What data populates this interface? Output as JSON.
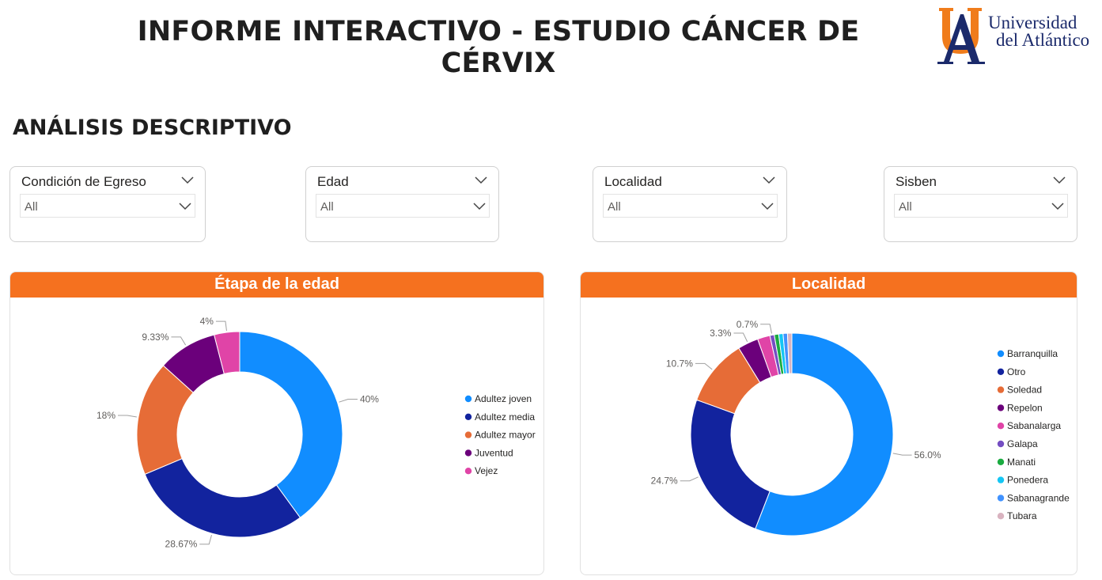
{
  "header": {
    "title": "INFORME INTERACTIVO - ESTUDIO CÁNCER DE CÉRVIX",
    "logo_line1": "Universidad",
    "logo_line2": "del Atlántico"
  },
  "section_title": "ANÁLISIS DESCRIPTIVO",
  "filters": [
    {
      "label": "Condición de Egreso",
      "value": "All"
    },
    {
      "label": "Edad",
      "value": "All"
    },
    {
      "label": "Localidad",
      "value": "All"
    },
    {
      "label": "Sisben",
      "value": "All"
    }
  ],
  "colors": {
    "accent": "#f5711f",
    "logo_orange": "#f07c1b",
    "logo_navy": "#1b2a6b"
  },
  "chart_data": [
    {
      "type": "pie",
      "title": "Étapa de la edad",
      "categories": [
        "Adultez joven",
        "Adultez media",
        "Adultez mayor",
        "Juventud",
        "Vejez"
      ],
      "values": [
        40,
        28.67,
        18,
        9.33,
        4
      ],
      "labels": [
        "40%",
        "28.67%",
        "18%",
        "9.33%",
        "4%"
      ],
      "colors": [
        "#118dff",
        "#12239e",
        "#e66c37",
        "#6b007b",
        "#e044a7"
      ],
      "legend": "right"
    },
    {
      "type": "pie",
      "title": "Localidad",
      "categories": [
        "Barranquilla",
        "Otro",
        "Soledad",
        "Repelon",
        "Sabanalarga",
        "Galapa",
        "Manati",
        "Ponedera",
        "Sabanagrande",
        "Tubara"
      ],
      "values": [
        56.0,
        24.7,
        10.7,
        3.3,
        2.0,
        0.7,
        0.7,
        0.7,
        0.7,
        0.7
      ],
      "labels": [
        "56.0%",
        "24.7%",
        "10.7%",
        "3.3%",
        "",
        "0.7%",
        "",
        "",
        "",
        ""
      ],
      "colors": [
        "#118dff",
        "#12239e",
        "#e66c37",
        "#6b007b",
        "#e044a7",
        "#744ec2",
        "#1aab40",
        "#15c6f4",
        "#4092ff",
        "#d9b3c0"
      ],
      "legend": "right"
    }
  ]
}
